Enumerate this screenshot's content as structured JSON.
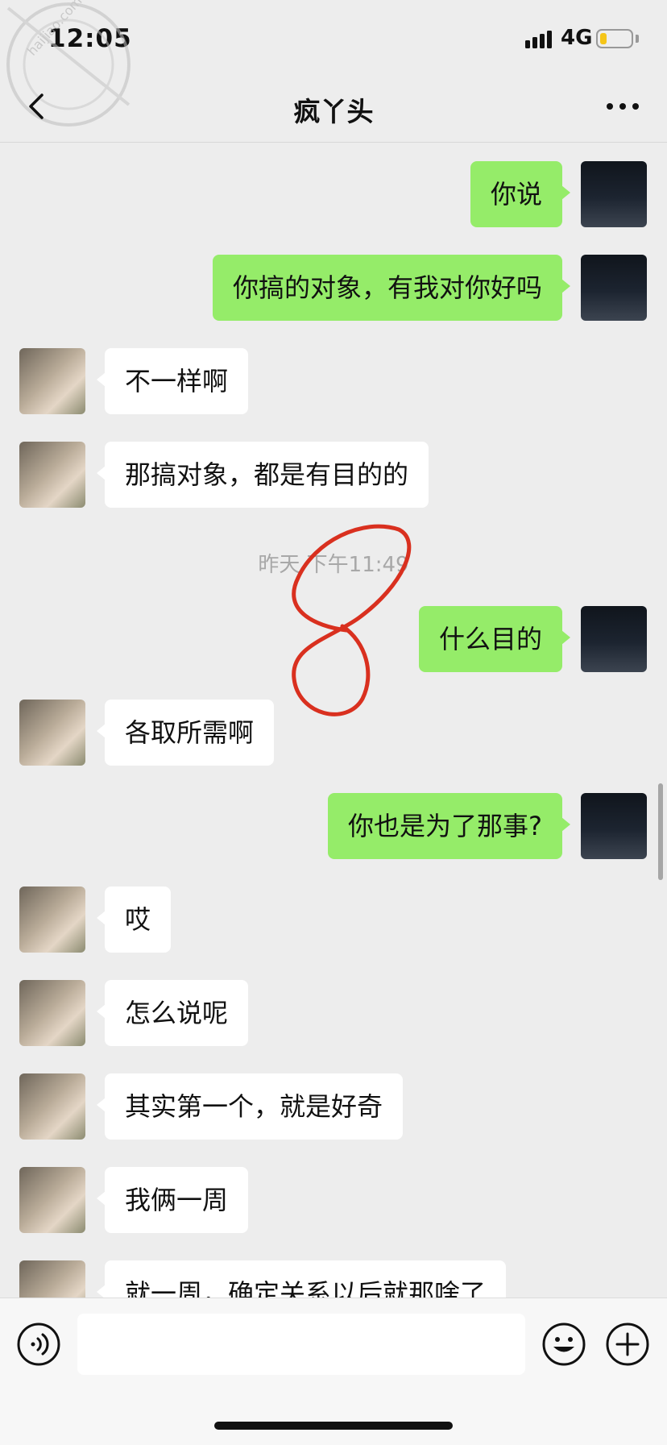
{
  "status_bar": {
    "time": "12:05",
    "network": "4G",
    "battery_level": 0.2
  },
  "watermark": {
    "text": "haijiao.com"
  },
  "header": {
    "title": "疯丫头"
  },
  "messages": [
    {
      "side": "me",
      "text": "你说"
    },
    {
      "side": "me",
      "text": "你搞的对象，有我对你好吗"
    },
    {
      "side": "her",
      "text": "不一样啊"
    },
    {
      "side": "her",
      "text": "那搞对象，都是有目的的"
    },
    {
      "side": "me",
      "text": "什么目的"
    },
    {
      "side": "her",
      "text": "各取所需啊"
    },
    {
      "side": "me",
      "text": "你也是为了那事?"
    },
    {
      "side": "her",
      "text": "哎"
    },
    {
      "side": "her",
      "text": "怎么说呢"
    },
    {
      "side": "her",
      "text": "其实第一个，就是好奇"
    },
    {
      "side": "her",
      "text": "我俩一周"
    },
    {
      "side": "her",
      "text": "就一周，确定关系以后就那啥了"
    }
  ],
  "timestamp": "昨天 下午11:49",
  "annotation": {
    "text": "8",
    "color": "#d9301f"
  },
  "input_bar": {
    "placeholder": ""
  }
}
